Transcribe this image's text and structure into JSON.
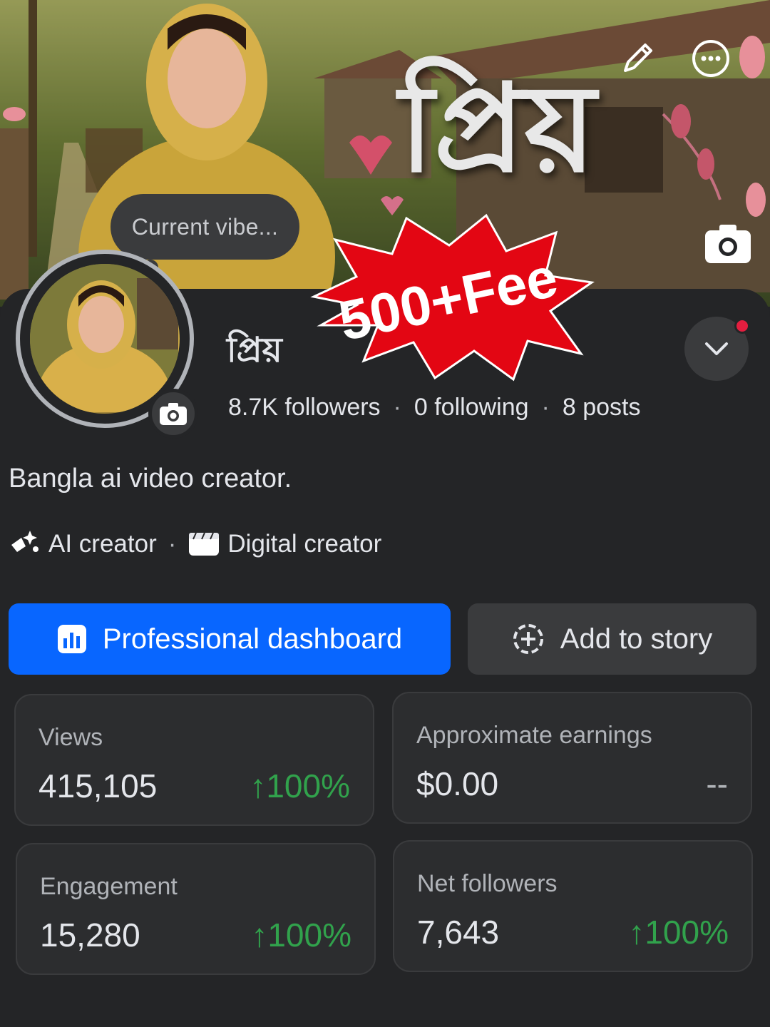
{
  "cover": {
    "title": "প্রিয়",
    "vibe_prompt": "Current vibe..."
  },
  "badge": {
    "text": "500+Fee"
  },
  "profile": {
    "name": "প্রিয়",
    "followers": "8.7K followers",
    "following": "0 following",
    "posts": "8 posts",
    "bio": "Bangla ai video creator.",
    "categories": [
      {
        "label": "AI creator",
        "icon": "sparkles-icon"
      },
      {
        "label": "Digital creator",
        "icon": "clapperboard-icon"
      }
    ]
  },
  "actions": {
    "primary": {
      "label": "Professional dashboard",
      "icon": "chart-icon"
    },
    "secondary": {
      "label": "Add to story",
      "icon": "plus-circle-icon"
    }
  },
  "metrics": [
    {
      "label": "Views",
      "value": "415,105",
      "change": "↑100%"
    },
    {
      "label": "Approximate earnings",
      "value": "$0.00",
      "change": "--"
    },
    {
      "label": "Engagement",
      "value": "15,280",
      "change": "↑100%"
    },
    {
      "label": "Net followers",
      "value": "7,643",
      "change": "↑100%"
    }
  ],
  "colors": {
    "background": "#242527",
    "accent": "#0866ff",
    "positive": "#31a24c",
    "badge": "#e30613",
    "notification": "#e41e3f"
  }
}
